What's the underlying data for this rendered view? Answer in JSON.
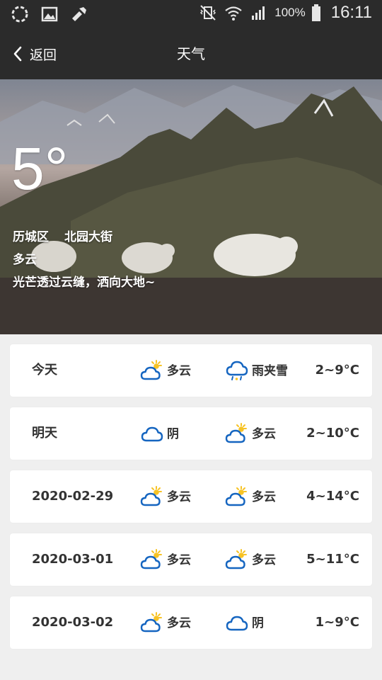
{
  "status_bar": {
    "battery_pct": "100%",
    "time": "16:11"
  },
  "header": {
    "back_label": "返回",
    "title": "天气"
  },
  "hero": {
    "temperature": "5°",
    "district": "历城区",
    "street": "北园大街",
    "condition": "多云",
    "description": "光芒透过云缝，洒向大地~"
  },
  "forecast": [
    {
      "date": "今天",
      "day_condition": "多云",
      "day_icon": "partly-cloudy",
      "night_condition": "雨夹雪",
      "night_icon": "sleet",
      "temp": "2~9°C"
    },
    {
      "date": "明天",
      "day_condition": "阴",
      "day_icon": "cloudy",
      "night_condition": "多云",
      "night_icon": "partly-cloudy",
      "temp": "2~10°C"
    },
    {
      "date": "2020-02-29",
      "day_condition": "多云",
      "day_icon": "partly-cloudy",
      "night_condition": "多云",
      "night_icon": "partly-cloudy",
      "temp": "4~14°C"
    },
    {
      "date": "2020-03-01",
      "day_condition": "多云",
      "day_icon": "partly-cloudy",
      "night_condition": "多云",
      "night_icon": "partly-cloudy",
      "temp": "5~11°C"
    },
    {
      "date": "2020-03-02",
      "day_condition": "多云",
      "day_icon": "partly-cloudy",
      "night_condition": "阴",
      "night_icon": "cloudy",
      "temp": "1~9°C"
    }
  ],
  "colors": {
    "bar_bg": "#2b2b2b",
    "page_bg": "#efefef",
    "icon_blue": "#1565c0",
    "sun_yellow": "#f7c325"
  }
}
